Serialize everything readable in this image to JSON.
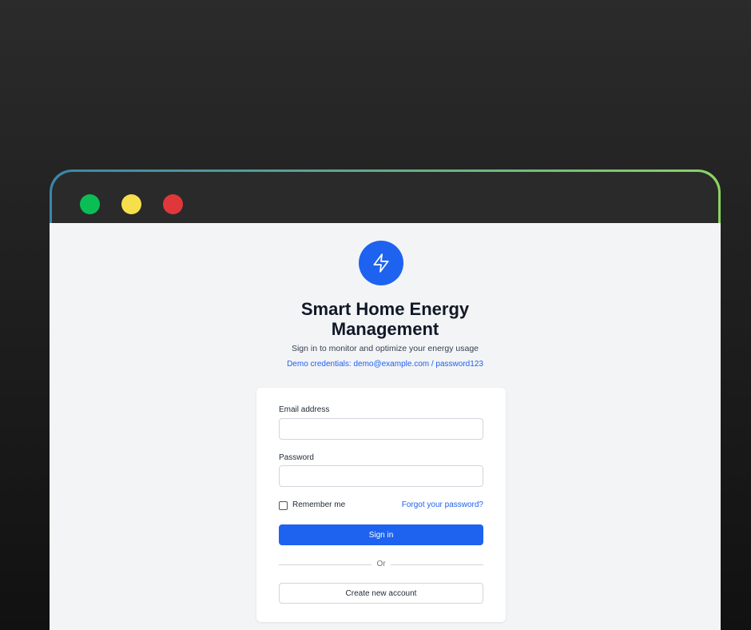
{
  "window": {
    "controls": [
      "green",
      "yellow",
      "red"
    ]
  },
  "header": {
    "logo_icon": "lightning-bolt-icon",
    "title_line1": "Smart Home Energy",
    "title_line2": "Management",
    "subtitle": "Sign in to monitor and optimize your energy usage",
    "demo_credentials": "Demo credentials: demo@example.com / password123"
  },
  "form": {
    "email_label": "Email address",
    "email_value": "",
    "password_label": "Password",
    "password_value": "",
    "remember_label": "Remember me",
    "remember_checked": false,
    "forgot_link": "Forgot your password?",
    "signin_label": "Sign in",
    "divider_text": "Or",
    "create_label": "Create new account"
  },
  "colors": {
    "accent": "#1e63f0",
    "background": "#f3f4f6",
    "titlebar": "#2a2a2a"
  }
}
